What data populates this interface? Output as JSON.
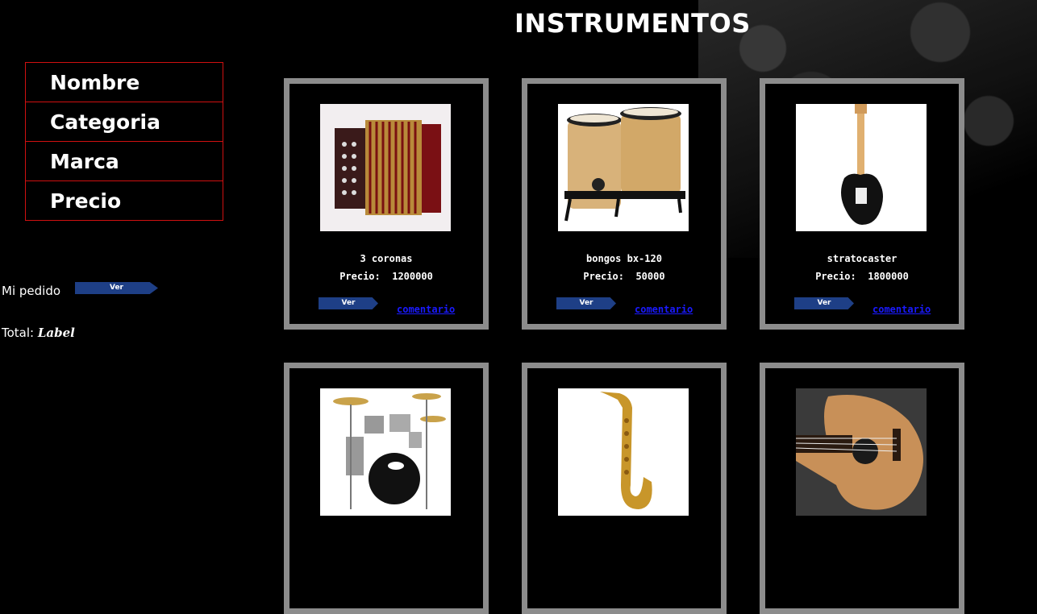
{
  "page": {
    "title": "INSTRUMENTOS"
  },
  "filters": [
    {
      "label": "Nombre"
    },
    {
      "label": "Categoria"
    },
    {
      "label": "Marca"
    },
    {
      "label": "Precio"
    }
  ],
  "order": {
    "label": "Mi pedido",
    "button_label": "Ver"
  },
  "total": {
    "label": "Total:",
    "value": "Label"
  },
  "products": [
    {
      "name": "3 coronas",
      "price_label": "Precio:",
      "price": "1200000",
      "view_label": "Ver",
      "comment_label": "comentario",
      "image_icon": "accordion-icon"
    },
    {
      "name": "bongos bx-120",
      "price_label": "Precio:",
      "price": "50000",
      "view_label": "Ver",
      "comment_label": "comentario",
      "image_icon": "bongos-icon"
    },
    {
      "name": "stratocaster",
      "price_label": "Precio:",
      "price": "1800000",
      "view_label": "Ver",
      "comment_label": "comentario",
      "image_icon": "electric-guitar-icon"
    },
    {
      "image_icon": "drum-kit-icon"
    },
    {
      "image_icon": "saxophone-icon"
    },
    {
      "image_icon": "acoustic-guitar-icon"
    }
  ],
  "colors": {
    "background": "#000000",
    "menu_border": "#d01010",
    "card_border": "#8c8c8c",
    "button": "#1e3f86",
    "link": "#1a1aff"
  }
}
